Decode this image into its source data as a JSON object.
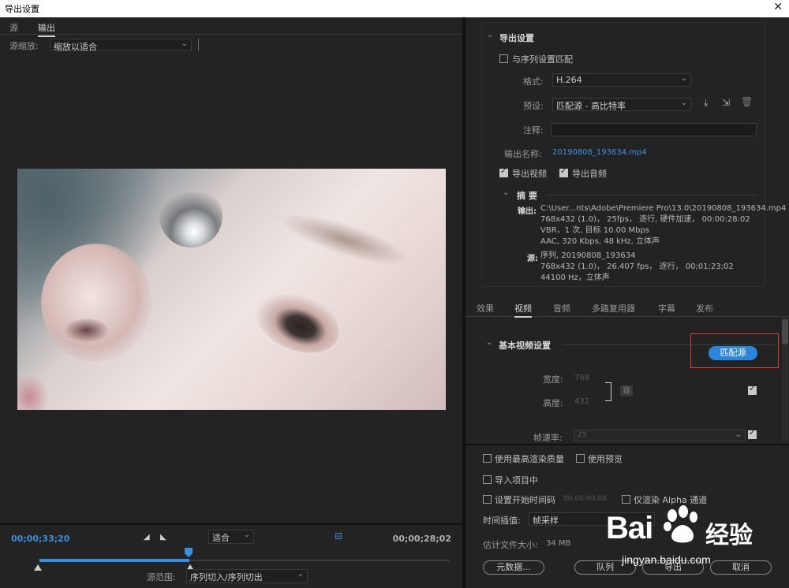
{
  "window": {
    "title": "导出设置",
    "close_glyph": "✕"
  },
  "left": {
    "tabs": [
      {
        "label": "源"
      },
      {
        "label": "输出"
      }
    ],
    "zoom_label": "源缩放:",
    "zoom_value": "缩放以适合",
    "timeline": {
      "current_timecode": "00;00;33;20",
      "duration_timecode": "00;00;28;02",
      "fit_value": "适合",
      "range_label": "源范围:",
      "range_value": "序列切入/序列切出"
    }
  },
  "export_settings": {
    "header": "导出设置",
    "match_sequence_label": "与序列设置匹配",
    "format_label": "格式:",
    "format_value": "H.264",
    "preset_label": "预设:",
    "preset_value": "匹配源 - 高比特率",
    "comment_label": "注释:",
    "output_name_label": "输出名称:",
    "output_name_value": "20190808_193634.mp4",
    "export_video_label": "导出视频",
    "export_audio_label": "导出音频",
    "summary_header": "摘 要",
    "summary_output_label": "输出:",
    "summary_output_lines": [
      "C:\\User...nts\\Adobe\\Premiere Pro\\13.0\\20190808_193634.mp4",
      "768x432 (1.0)， 25fps， 逐行, 硬件加速， 00:00:28:02",
      "VBR，1 次, 目标 10.00 Mbps",
      "AAC, 320 Kbps, 48  kHz, 立体声"
    ],
    "summary_source_label": "源:",
    "summary_source_lines": [
      "序列, 20190808_193634",
      "768x432 (1.0)， 26.407  fps， 逐行， 00;01;23;02",
      "44100 Hz，立体声"
    ]
  },
  "right_tabs": [
    {
      "label": "效果"
    },
    {
      "label": "视频"
    },
    {
      "label": "音频"
    },
    {
      "label": "多路复用器"
    },
    {
      "label": "字幕"
    },
    {
      "label": "发布"
    }
  ],
  "video_settings": {
    "header": "基本视频设置",
    "match_source_button": "匹配源",
    "width_label": "宽度:",
    "width_value": "768",
    "height_label": "高度:",
    "height_value": "432",
    "frame_rate_label": "帧速率:",
    "frame_rate_value": "25"
  },
  "bottom": {
    "max_render_label": "使用最高渲染质量",
    "use_preview_label": "使用预览",
    "import_project_label": "导入项目中",
    "set_start_tc_label": "设置开始时间码",
    "start_tc_value": "00:00:00:00",
    "alpha_only_label": "仅渲染 Alpha 通道",
    "time_interp_label": "时间插值:",
    "time_interp_value": "帧采样",
    "file_size_label": "估计文件大小:",
    "file_size_value": "34 MB",
    "metadata_button": "元数据...",
    "queue_button": "队列",
    "export_button": "导出",
    "cancel_button": "取消"
  },
  "watermark": {
    "brand": "Bai",
    "brand_cn": "经验",
    "url": "jingyan.baidu.com"
  },
  "colors": {
    "accent": "#2c85d8",
    "timecode": "#3d8fe0",
    "highlight_box": "#e23a3a"
  }
}
